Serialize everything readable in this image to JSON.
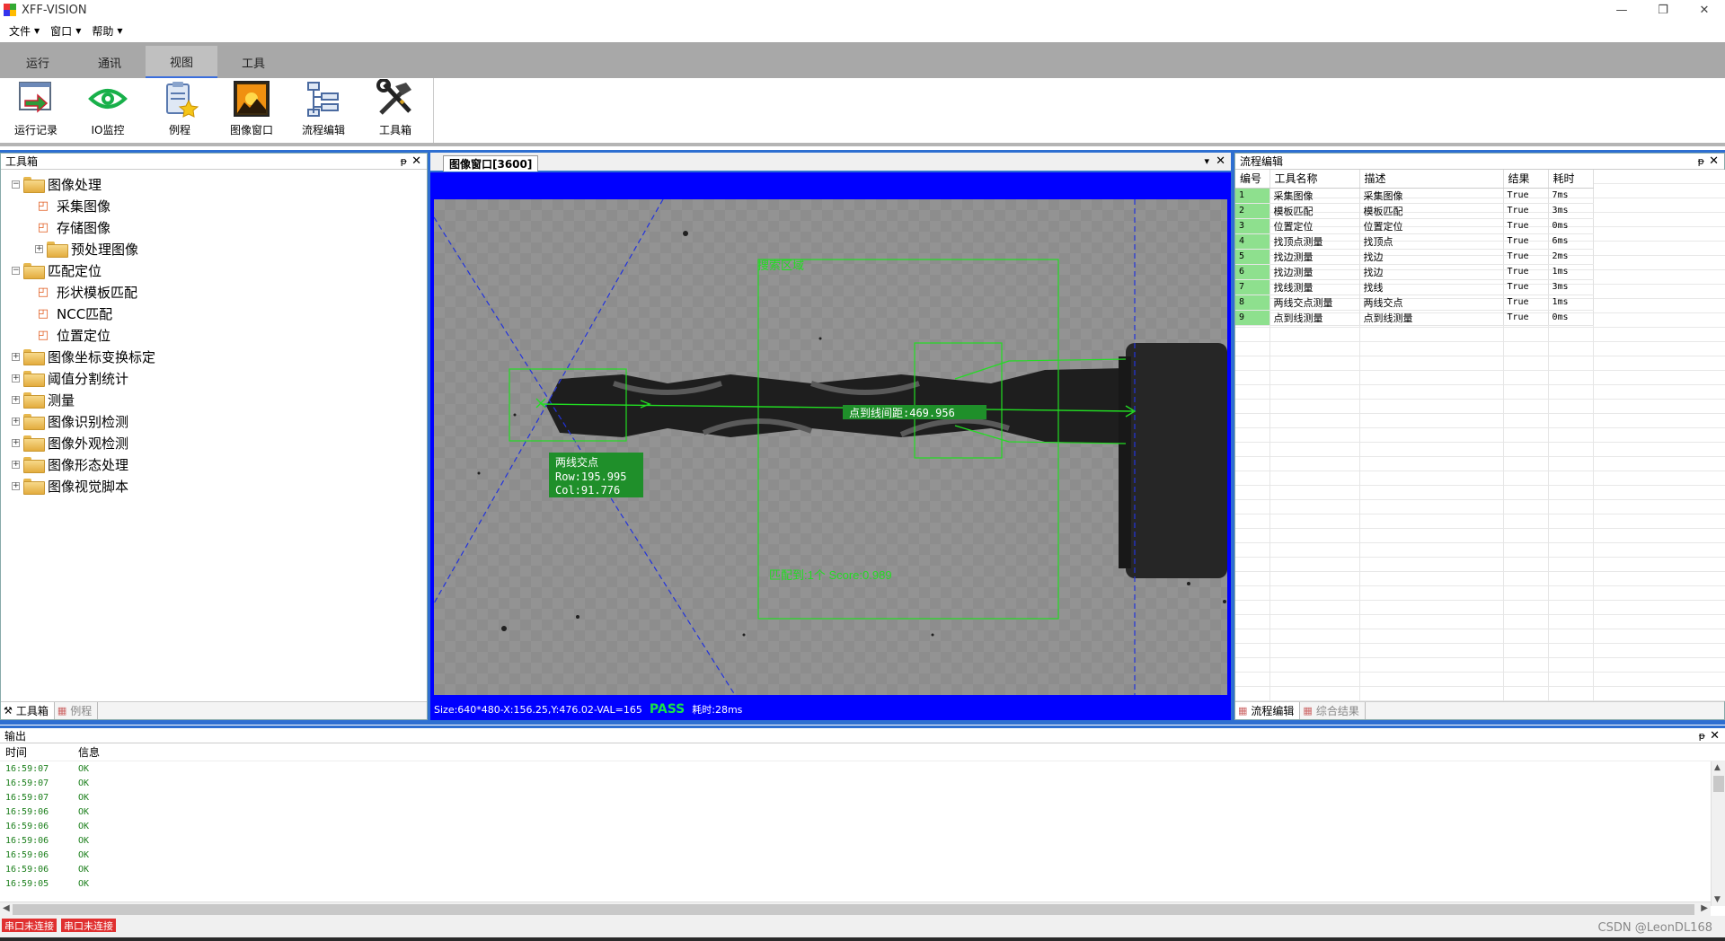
{
  "window": {
    "title": "XFF-VISION",
    "minimize": "—",
    "restore": "❐",
    "close": "✕"
  },
  "menu": [
    "文件",
    "窗口",
    "帮助"
  ],
  "ribbon_tabs": [
    {
      "label": "运行",
      "active": false
    },
    {
      "label": "通讯",
      "active": false
    },
    {
      "label": "视图",
      "active": true
    },
    {
      "label": "工具",
      "active": false
    }
  ],
  "ribbon_buttons": [
    {
      "label": "运行记录",
      "icon": "run-log-icon"
    },
    {
      "label": "IO监控",
      "icon": "eye-icon"
    },
    {
      "label": "例程",
      "icon": "clipboard-star-icon"
    },
    {
      "label": "图像窗口",
      "icon": "image-window-icon"
    },
    {
      "label": "流程编辑",
      "icon": "flow-edit-icon"
    },
    {
      "label": "工具箱",
      "icon": "toolbox-icon"
    }
  ],
  "toolbox": {
    "title": "工具箱",
    "pin": "ᵽ",
    "close": "✕",
    "tree": [
      {
        "label": "图像处理",
        "level": 0,
        "type": "folder",
        "expand": "−"
      },
      {
        "label": "采集图像",
        "level": 1,
        "type": "leaf"
      },
      {
        "label": "存储图像",
        "level": 1,
        "type": "leaf"
      },
      {
        "label": "预处理图像",
        "level": 1,
        "type": "folder",
        "expand": "+"
      },
      {
        "label": "匹配定位",
        "level": 0,
        "type": "folder",
        "expand": "−"
      },
      {
        "label": "形状模板匹配",
        "level": 1,
        "type": "leaf"
      },
      {
        "label": "NCC匹配",
        "level": 1,
        "type": "leaf"
      },
      {
        "label": "位置定位",
        "level": 1,
        "type": "leaf"
      },
      {
        "label": "图像坐标变换标定",
        "level": 0,
        "type": "folder",
        "expand": "+"
      },
      {
        "label": "阈值分割统计",
        "level": 0,
        "type": "folder",
        "expand": "+"
      },
      {
        "label": "测量",
        "level": 0,
        "type": "folder",
        "expand": "+"
      },
      {
        "label": "图像识别检测",
        "level": 0,
        "type": "folder",
        "expand": "+"
      },
      {
        "label": "图像外观检测",
        "level": 0,
        "type": "folder",
        "expand": "+"
      },
      {
        "label": "图像形态处理",
        "level": 0,
        "type": "folder",
        "expand": "+"
      },
      {
        "label": "图像视觉脚本",
        "level": 0,
        "type": "folder",
        "expand": "+"
      }
    ],
    "footer_tabs": [
      "工具箱",
      "例程"
    ]
  },
  "image_window": {
    "tab": "图像窗口[3600]",
    "dropdown": "▾",
    "close": "✕",
    "overlay": {
      "search_region": "搜索区域",
      "distance_label": "点到线间距:469.956",
      "intersection_title": "两线交点",
      "row": "Row:195.995",
      "col": "Col:91.776",
      "match_text": "匹配到:1个 Score:0.989"
    },
    "status": {
      "info": "Size:640*480-X:156.25,Y:476.02-VAL=165",
      "result": "PASS",
      "elapsed": "耗时:28ms"
    }
  },
  "flow_editor": {
    "title": "流程编辑",
    "pin": "ᵽ",
    "close": "✕",
    "columns": [
      "编号",
      "工具名称",
      "描述",
      "结果",
      "耗时"
    ],
    "rows": [
      [
        "1",
        "采集图像",
        "采集图像",
        "True",
        "7ms"
      ],
      [
        "2",
        "模板匹配",
        "模板匹配",
        "True",
        "3ms"
      ],
      [
        "3",
        "位置定位",
        "位置定位",
        "True",
        "0ms"
      ],
      [
        "4",
        "找顶点测量",
        "找顶点",
        "True",
        "6ms"
      ],
      [
        "5",
        "找边测量",
        "找边",
        "True",
        "2ms"
      ],
      [
        "6",
        "找边测量",
        "找边",
        "True",
        "1ms"
      ],
      [
        "7",
        "找线测量",
        "找线",
        "True",
        "3ms"
      ],
      [
        "8",
        "两线交点测量",
        "两线交点",
        "True",
        "1ms"
      ],
      [
        "9",
        "点到线测量",
        "点到线测量",
        "True",
        "0ms"
      ]
    ],
    "footer_tabs": [
      "流程编辑",
      "综合结果"
    ]
  },
  "output": {
    "title": "输出",
    "pin": "ᵽ",
    "close": "✕",
    "columns": [
      "时间",
      "信息"
    ],
    "rows": [
      [
        "16:59:07",
        "OK"
      ],
      [
        "16:59:07",
        "OK"
      ],
      [
        "16:59:07",
        "OK"
      ],
      [
        "16:59:06",
        "OK"
      ],
      [
        "16:59:06",
        "OK"
      ],
      [
        "16:59:06",
        "OK"
      ],
      [
        "16:59:06",
        "OK"
      ],
      [
        "16:59:06",
        "OK"
      ],
      [
        "16:59:05",
        "OK"
      ]
    ]
  },
  "statusbar": {
    "serial1": "串口未连接",
    "serial2": "串口未连接",
    "watermark": "CSDN @LeonDL168"
  },
  "colors": {
    "accent_blue": "#2e6fd1",
    "overlay_green": "#22dd22",
    "pass_green": "#18e04a",
    "error_red": "#e03030"
  }
}
